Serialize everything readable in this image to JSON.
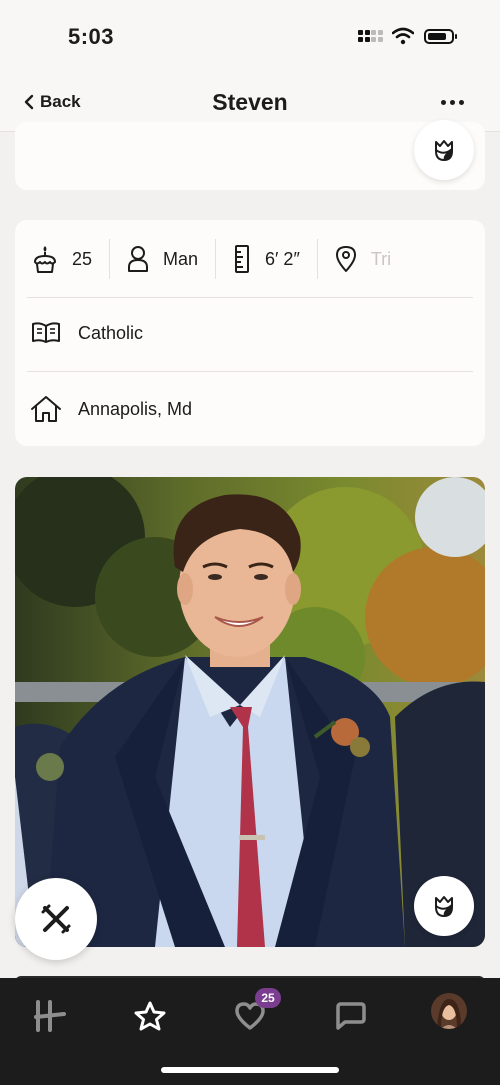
{
  "status_bar": {
    "time": "5:03"
  },
  "nav": {
    "back_label": "Back",
    "title": "Steven"
  },
  "profile": {
    "vitals": [
      {
        "icon": "cake-icon",
        "value": "25"
      },
      {
        "icon": "person-icon",
        "value": "Man"
      },
      {
        "icon": "ruler-icon",
        "value": "6′ 2″"
      },
      {
        "icon": "location-pin-icon",
        "value": "Tri"
      }
    ],
    "religion": "Catholic",
    "hometown": "Annapolis, Md"
  },
  "tab_bar": {
    "items": [
      "hinge-logo-icon",
      "star-icon",
      "heart-likes-icon",
      "chat-icon",
      "profile-avatar"
    ],
    "likes_badge": "25"
  },
  "colors": {
    "background": "#f3f1ef",
    "tab_bar": "#1c1c1c",
    "badge": "#7b3d8f"
  }
}
